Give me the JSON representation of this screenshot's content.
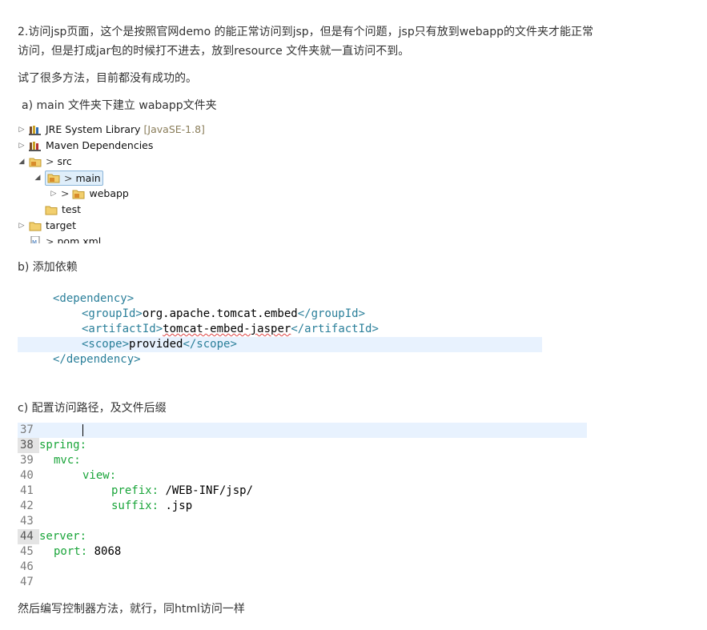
{
  "paragraphs": {
    "p1_line1": "2.访问jsp页面，这个是按照官网demo 的能正常访问到jsp，但是有个问题，jsp只有放到webapp的文件夹才能正常",
    "p1_line2": "访问，但是打成jar包的时候打不进去，放到resource 文件夹就一直访问不到。",
    "p2": "试了很多方法，目前都没有成功的。",
    "p3": "a) main 文件夹下建立 wabapp文件夹",
    "p4": "b) 添加依赖",
    "p5": "c)  配置访问路径，及文件后缀",
    "p6": "然后编写控制器方法，就行，同html访问一样"
  },
  "tree": {
    "items": [
      {
        "label": "JRE System Library",
        "suffix": "[JavaSE-1.8]",
        "icon": "library-icon",
        "expand": "collapsed"
      },
      {
        "label": "Maven Dependencies",
        "suffix": "",
        "icon": "library-icon",
        "expand": "collapsed"
      },
      {
        "label": "src",
        "prefix": ">",
        "icon": "source-folder-icon",
        "expand": "expanded"
      },
      {
        "label": "main",
        "prefix": ">",
        "icon": "source-folder-icon",
        "expand": "expanded",
        "selected": true
      },
      {
        "label": "webapp",
        "prefix": ">",
        "icon": "source-folder-icon",
        "expand": "collapsed"
      },
      {
        "label": "test",
        "prefix": "",
        "icon": "folder-icon",
        "expand": "none"
      },
      {
        "label": "target",
        "prefix": "",
        "icon": "folder-icon",
        "expand": "collapsed"
      },
      {
        "label": "pom.xml",
        "prefix": ">",
        "icon": "xml-file-icon",
        "expand": "none"
      }
    ]
  },
  "xml_code": {
    "lines": [
      {
        "open": "<dependency>",
        "text": "",
        "close": ""
      },
      {
        "open": "<groupId>",
        "text": "org.apache.tomcat.embed",
        "close": "</groupId>"
      },
      {
        "open": "<artifactId>",
        "text": "tomcat-embed-jasper",
        "close": "</artifactId>"
      },
      {
        "open": "<scope>",
        "text": "provided",
        "close": "</scope>"
      },
      {
        "open": "</dependency>",
        "text": "",
        "close": ""
      }
    ]
  },
  "yaml_code": {
    "lines": [
      {
        "num": "37",
        "key": "",
        "val": ""
      },
      {
        "num": "38",
        "key": "spring:",
        "val": ""
      },
      {
        "num": "39",
        "key": "mvc:",
        "val": ""
      },
      {
        "num": "40",
        "key": "view:",
        "val": ""
      },
      {
        "num": "41",
        "key": "prefix:",
        "val": " /WEB-INF/jsp/"
      },
      {
        "num": "42",
        "key": "suffix:",
        "val": " .jsp"
      },
      {
        "num": "43",
        "key": "",
        "val": ""
      },
      {
        "num": "44",
        "key": "server:",
        "val": ""
      },
      {
        "num": "45",
        "key": "port:",
        "val": " 8068"
      },
      {
        "num": "46",
        "key": "",
        "val": ""
      },
      {
        "num": "47",
        "key": "",
        "val": ""
      }
    ]
  },
  "colors": {
    "xml_tag": "#2a7f9a",
    "yaml_key": "#1aa53a",
    "highlight_line": "#e8f2fe",
    "tree_selection": "#dfeefa"
  }
}
